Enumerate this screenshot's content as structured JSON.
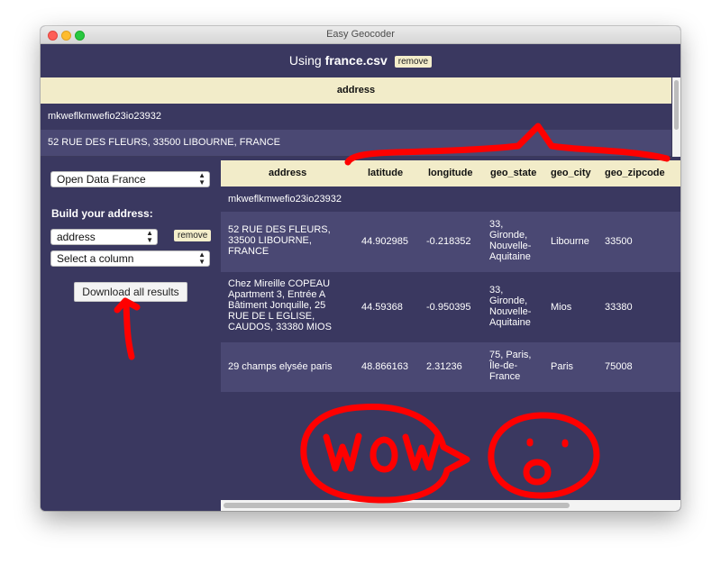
{
  "window": {
    "title": "Easy Geocoder"
  },
  "header": {
    "using_prefix": "Using",
    "filename": "france.csv",
    "remove_label": "remove"
  },
  "input_table": {
    "column": "address",
    "rows": [
      "mkweflkmwefio23io23932",
      "52 RUE DES FLEURS, 33500 LIBOURNE, FRANCE"
    ]
  },
  "sidebar": {
    "source_select": "Open Data France",
    "build_label": "Build your address:",
    "column_select": "address",
    "remove_label": "remove",
    "add_column_select": "Select a column",
    "download_label": "Download all results"
  },
  "results": {
    "headers": [
      "address",
      "latitude",
      "longitude",
      "geo_state",
      "geo_city",
      "geo_zipcode"
    ],
    "rows": [
      {
        "address": "mkweflkmwefio23io23932",
        "latitude": "",
        "longitude": "",
        "geo_state": "",
        "geo_city": "",
        "geo_zipcode": ""
      },
      {
        "address": "52 RUE DES FLEURS, 33500 LIBOURNE, FRANCE",
        "latitude": "44.902985",
        "longitude": "-0.218352",
        "geo_state": "33, Gironde, Nouvelle-Aquitaine",
        "geo_city": "Libourne",
        "geo_zipcode": "33500"
      },
      {
        "address": "Chez Mireille COPEAU Apartment 3, Entrée A Bâtiment Jonquille, 25 RUE DE L EGLISE, CAUDOS, 33380 MIOS",
        "latitude": "44.59368",
        "longitude": "-0.950395",
        "geo_state": "33, Gironde, Nouvelle-Aquitaine",
        "geo_city": "Mios",
        "geo_zipcode": "33380"
      },
      {
        "address": "29 champs elysée paris",
        "latitude": "48.866163",
        "longitude": "2.31236",
        "geo_state": "75, Paris, Île-de-France",
        "geo_city": "Paris",
        "geo_zipcode": "75008"
      }
    ]
  },
  "annotations": {
    "handwritten": "WOW",
    "color": "#ff0000"
  }
}
